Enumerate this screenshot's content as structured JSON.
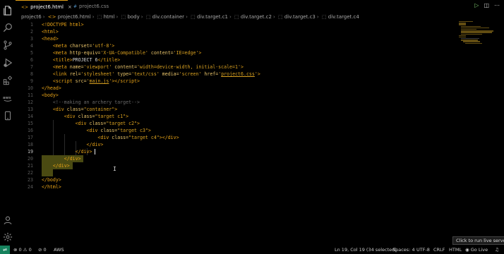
{
  "tabs": [
    {
      "label": "project6.html",
      "icon": "html-file-icon",
      "active": true,
      "close": "×"
    },
    {
      "label": "project6.css",
      "icon": "css-file-icon",
      "active": false
    }
  ],
  "breadcrumb": [
    "project6",
    "project6.html",
    "html",
    "body",
    "div.container",
    "div.target.c1",
    "div.target.c2",
    "div.target.c3",
    "div.target.c4"
  ],
  "editor": {
    "lines": [
      {
        "n": "1",
        "html": "<span class=\"tg\">&lt;!DOCTYPE html&gt;</span>"
      },
      {
        "n": "2",
        "html": "<span class=\"tg\">&lt;html&gt;</span>"
      },
      {
        "n": "3",
        "html": "<span class=\"tg\">&lt;head&gt;</span>"
      },
      {
        "n": "4",
        "html": "    <span class=\"tg\">&lt;meta</span> <span class=\"at\">charset=</span><span class=\"st\">'utf-8'</span><span class=\"tg\">&gt;</span>"
      },
      {
        "n": "5",
        "html": "    <span class=\"tg\">&lt;meta</span> <span class=\"at\">http-equiv=</span><span class=\"st\">'X-UA-Compatible'</span> <span class=\"at\">content=</span><span class=\"st\">'IE=edge'</span><span class=\"tg\">&gt;</span>"
      },
      {
        "n": "6",
        "html": "    <span class=\"tg\">&lt;title&gt;</span>PROJECT 6<span class=\"tg\">&lt;/title&gt;</span>"
      },
      {
        "n": "7",
        "html": "    <span class=\"tg\">&lt;meta</span> <span class=\"at\">name=</span><span class=\"st\">'viewport'</span> <span class=\"at\">content=</span><span class=\"st\">'width=device-width, initial-scale=1'</span><span class=\"tg\">&gt;</span>"
      },
      {
        "n": "8",
        "html": "    <span class=\"tg\">&lt;link</span> <span class=\"at\">rel=</span><span class=\"st\">'stylesheet'</span> <span class=\"at\">type=</span><span class=\"st\">'text/css'</span> <span class=\"at\">media=</span><span class=\"st\">'screen'</span> <span class=\"at\">href=</span><span class=\"st\">'<span class=\"ul\">project6.css</span>'</span><span class=\"tg\">&gt;</span>"
      },
      {
        "n": "9",
        "html": "    <span class=\"tg\">&lt;script</span> <span class=\"at\">src=</span><span class=\"st\">'<span class=\"ul\">main.js</span>'</span><span class=\"tg\">&gt;&lt;/script&gt;</span>"
      },
      {
        "n": "10",
        "html": "<span class=\"tg\">&lt;/head&gt;</span>"
      },
      {
        "n": "11",
        "html": "<span class=\"tg\">&lt;body&gt;</span>"
      },
      {
        "n": "12",
        "html": "    <span class=\"cm\">&lt;!--making an archery target--&gt;</span>"
      },
      {
        "n": "13",
        "html": "    <span class=\"tg\">&lt;div</span> <span class=\"at\">class=</span><span class=\"st\">\"container\"</span><span class=\"tg\">&gt;</span>"
      },
      {
        "n": "14",
        "html": "        <span class=\"tg\">&lt;div</span> <span class=\"at\">class=</span><span class=\"st\">\"target c1\"</span><span class=\"tg\">&gt;</span>"
      },
      {
        "n": "15",
        "html": "            <span class=\"tg\">&lt;div</span> <span class=\"at\">class=</span><span class=\"st\">\"target c2\"</span><span class=\"tg\">&gt;</span>"
      },
      {
        "n": "16",
        "html": "                <span class=\"tg\">&lt;div</span> <span class=\"at\">class=</span><span class=\"st\">\"target c3\"</span><span class=\"tg\">&gt;</span>"
      },
      {
        "n": "17",
        "html": "                    <span class=\"tg\">&lt;div</span> <span class=\"at\">class=</span><span class=\"st\">\"target c4\"</span><span class=\"tg\">&gt;&lt;/div&gt;</span>"
      },
      {
        "n": "18",
        "html": "                <span class=\"tg\">&lt;/div&gt;</span>"
      },
      {
        "n": "19",
        "html": "            <span class=\"tg\">&lt;/div&gt;</span>"
      },
      {
        "n": "20",
        "html": "        <span class=\"tg\">&lt;/div&gt;</span>"
      },
      {
        "n": "21",
        "html": "    <span class=\"tg\">&lt;/div&gt;</span>"
      },
      {
        "n": "22",
        "html": ""
      },
      {
        "n": "23",
        "html": "<span class=\"tg\">&lt;/body&gt;</span>"
      },
      {
        "n": "24",
        "html": "<span class=\"tg\">&lt;/html&gt;</span>"
      }
    ],
    "current_line": "19"
  },
  "tooltip": "Click to run live server",
  "status": {
    "errors": "0",
    "warnings": "0",
    "ports": "0",
    "aws": "AWS",
    "position": "Ln 19, Col 19 (34 selected)",
    "spaces": "Spaces: 4",
    "encoding": "UTF-8",
    "eol": "CRLF",
    "language": "HTML",
    "live": "Go Live"
  },
  "colors": {
    "accent": "#e8a317",
    "selection": "#4a4a12",
    "remote": "#16825d"
  }
}
